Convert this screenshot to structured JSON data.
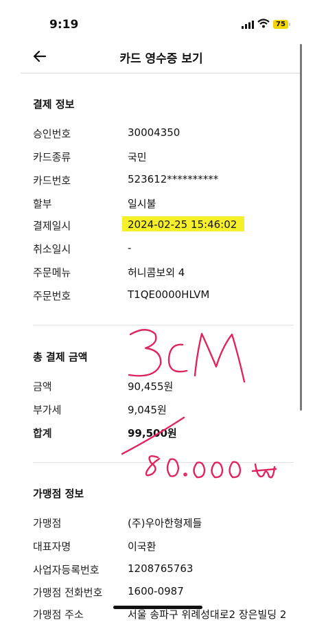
{
  "status_bar": {
    "time": "9:19",
    "battery": "75"
  },
  "header": {
    "title": "카드 영수증 보기"
  },
  "payment_info": {
    "title": "결제 정보",
    "rows": [
      {
        "label": "승인번호",
        "value": "30004350"
      },
      {
        "label": "카드종류",
        "value": "국민"
      },
      {
        "label": "카드번호",
        "value": "523612**********"
      },
      {
        "label": "할부",
        "value": "일시불"
      },
      {
        "label": "결제일시",
        "value": "2024-02-25 15:46:02"
      },
      {
        "label": "취소일시",
        "value": "-"
      },
      {
        "label": "주문메뉴",
        "value": "허니콤보외 4"
      },
      {
        "label": "주문번호",
        "value": "T1QE0000HLVM"
      }
    ]
  },
  "total_amount": {
    "title": "총 결제 금액",
    "rows": [
      {
        "label": "금액",
        "value": "90,455원"
      },
      {
        "label": "부가세",
        "value": "9,045원"
      },
      {
        "label": "합계",
        "value": "99,500원"
      }
    ]
  },
  "merchant_info": {
    "title": "가맹점 정보",
    "rows": [
      {
        "label": "가맹점",
        "value": "(주)우아한형제들"
      },
      {
        "label": "대표자명",
        "value": "이국환"
      },
      {
        "label": "사업자등록번호",
        "value": "1208765763"
      },
      {
        "label": "가맹점 전화번호",
        "value": "1600-0987"
      },
      {
        "label": "가맹점 주소",
        "value": "서울 송파구 위례성대로2 장은빌딩 2"
      }
    ]
  },
  "colors": {
    "highlight": "#f6f02a",
    "handwriting": "#e0245e",
    "battery": "#f5d600"
  }
}
